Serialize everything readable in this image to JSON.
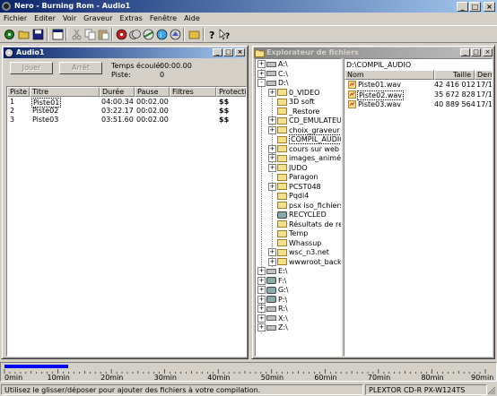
{
  "window": {
    "title": "Nero - Burning Rom - Audio1"
  },
  "menu": [
    "Fichier",
    "Editer",
    "Voir",
    "Graveur",
    "Extras",
    "Fenêtre",
    "Aide"
  ],
  "audio_window": {
    "title": "Audio1",
    "play_button": "Jouer",
    "stop_button": "Arrêt",
    "elapsed_label": "Temps écoulé:",
    "elapsed_value": "00:00.00",
    "track_label": "Piste:",
    "track_value": "0",
    "columns": [
      "Piste",
      "Titre",
      "Durée",
      "Pause",
      "Filtres",
      "Protection"
    ],
    "tracks": [
      {
        "num": "1",
        "title": "Piste01",
        "duration": "04:00.34",
        "pause": "00:02.00",
        "protection": "$$"
      },
      {
        "num": "2",
        "title": "Piste02",
        "duration": "03:22.17",
        "pause": "00:02.00",
        "protection": "$$"
      },
      {
        "num": "3",
        "title": "Piste03",
        "duration": "03:51.60",
        "pause": "00:02.00",
        "protection": "$$"
      }
    ]
  },
  "explorer_window": {
    "title": "Explorateur de fichiers",
    "tree": [
      {
        "label": "A:\\",
        "type": "drive",
        "level": 0,
        "pm": "+"
      },
      {
        "label": "C:\\",
        "type": "drive",
        "level": 0,
        "pm": "+"
      },
      {
        "label": "D:\\",
        "type": "drive",
        "level": 0,
        "pm": "-"
      },
      {
        "label": "0_VIDEO",
        "type": "folder",
        "level": 1,
        "pm": "+"
      },
      {
        "label": "3D soft",
        "type": "folder",
        "level": 1,
        "pm": ""
      },
      {
        "label": "_Restore",
        "type": "folder",
        "level": 1,
        "pm": ""
      },
      {
        "label": "CD_EMULATEUR",
        "type": "folder",
        "level": 1,
        "pm": "+"
      },
      {
        "label": "choix_graveur",
        "type": "folder",
        "level": 1,
        "pm": "+"
      },
      {
        "label": "COMPIL_AUDIO",
        "type": "folder",
        "level": 1,
        "pm": "",
        "selected": true
      },
      {
        "label": "cours sur web",
        "type": "folder",
        "level": 1,
        "pm": "+"
      },
      {
        "label": "images_animée",
        "type": "folder",
        "level": 1,
        "pm": "+"
      },
      {
        "label": "JUDO",
        "type": "folder",
        "level": 1,
        "pm": "+"
      },
      {
        "label": "Paragon",
        "type": "folder",
        "level": 1,
        "pm": ""
      },
      {
        "label": "PCST048",
        "type": "folder",
        "level": 1,
        "pm": "+"
      },
      {
        "label": "Pqdi4",
        "type": "folder",
        "level": 1,
        "pm": ""
      },
      {
        "label": "psx iso_fichiers",
        "type": "folder",
        "level": 1,
        "pm": ""
      },
      {
        "label": "RECYCLED",
        "type": "recycle",
        "level": 1,
        "pm": ""
      },
      {
        "label": "Résultats de rech",
        "type": "folder",
        "level": 1,
        "pm": ""
      },
      {
        "label": "Temp",
        "type": "folder",
        "level": 1,
        "pm": ""
      },
      {
        "label": "Whassup",
        "type": "folder",
        "level": 1,
        "pm": ""
      },
      {
        "label": "wsc_n3.net",
        "type": "folder",
        "level": 1,
        "pm": "+"
      },
      {
        "label": "wwwroot_backup",
        "type": "folder",
        "level": 1,
        "pm": "+"
      },
      {
        "label": "E:\\",
        "type": "drive",
        "level": 0,
        "pm": "+"
      },
      {
        "label": "F:\\",
        "type": "net",
        "level": 0,
        "pm": "+"
      },
      {
        "label": "G:\\",
        "type": "net",
        "level": 0,
        "pm": "+"
      },
      {
        "label": "P:\\",
        "type": "net",
        "level": 0,
        "pm": "+"
      },
      {
        "label": "R:\\",
        "type": "drive",
        "level": 0,
        "pm": "+"
      },
      {
        "label": "X:\\",
        "type": "drive",
        "level": 0,
        "pm": "+"
      },
      {
        "label": "Z:\\",
        "type": "drive",
        "level": 0,
        "pm": "+"
      }
    ],
    "path": "D:\\COMPIL_AUDIO",
    "file_columns": [
      "Nom",
      "Taille",
      "Derni"
    ],
    "files": [
      {
        "name": "Piste01.wav",
        "size": "42 416 012",
        "date": "17/1"
      },
      {
        "name": "Piste02.wav",
        "size": "35 672 828",
        "date": "17/1"
      },
      {
        "name": "Piste03.wav",
        "size": "40 889 564",
        "date": "17/1"
      }
    ]
  },
  "ruler": {
    "labels": [
      "0min",
      "10min",
      "20min",
      "30min",
      "40min",
      "50min",
      "60min",
      "70min",
      "80min",
      "90min"
    ],
    "progress": 0.132,
    "fill_color": "#0000ff"
  },
  "statusbar": {
    "message": "Utilisez le glisser/déposer pour ajouter des fichiers à votre compilation.",
    "recorder": "PLEXTOR  CD-R  PX-W124TS"
  },
  "colors": {
    "titlebar": "#0a246a",
    "face": "#d4d0c8"
  }
}
